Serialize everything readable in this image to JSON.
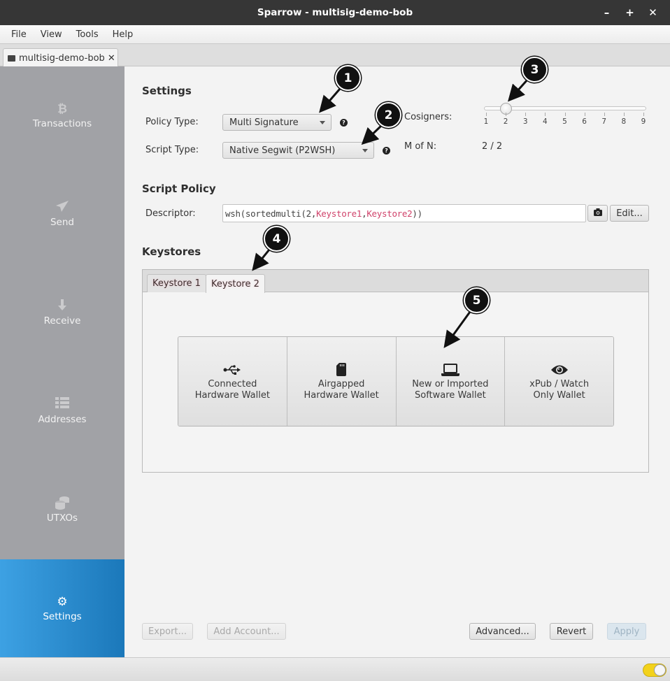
{
  "window": {
    "title": "Sparrow - multisig-demo-bob",
    "controls": {
      "minimize": "–",
      "maximize": "+",
      "close": "✕"
    }
  },
  "menu": [
    "File",
    "View",
    "Tools",
    "Help"
  ],
  "document_tab": {
    "label": "multisig-demo-bob",
    "icon": "wallet-icon",
    "close": "✕"
  },
  "sidebar": {
    "items": [
      {
        "label": "Transactions",
        "icon": "bitcoin-icon",
        "glyph": "₿",
        "active": false
      },
      {
        "label": "Send",
        "icon": "paper-plane-icon",
        "glyph": "➤",
        "active": false
      },
      {
        "label": "Receive",
        "icon": "arrow-down-icon",
        "glyph": "🡇",
        "active": false
      },
      {
        "label": "Addresses",
        "icon": "list-icon",
        "glyph": "☰",
        "active": false
      },
      {
        "label": "UTXOs",
        "icon": "coins-icon",
        "glyph": "⛁",
        "active": false
      },
      {
        "label": "Settings",
        "icon": "gear-icon",
        "glyph": "⚙",
        "active": true
      }
    ]
  },
  "settings": {
    "title": "Settings",
    "policy_type": {
      "label": "Policy Type:",
      "value": "Multi Signature",
      "help": "?"
    },
    "script_type": {
      "label": "Script Type:",
      "value": "Native Segwit (P2WSH)",
      "help": "?"
    },
    "cosigners": {
      "label": "Cosigners:",
      "min": 1,
      "max": 9,
      "value": 2,
      "ticks": [
        "1",
        "2",
        "3",
        "4",
        "5",
        "6",
        "7",
        "8",
        "9"
      ]
    },
    "m_of_n": {
      "label": "M of N:",
      "value": "2 / 2"
    }
  },
  "script_policy": {
    "title": "Script Policy",
    "descriptor_label": "Descriptor:",
    "descriptor": {
      "prefix": "wsh(sortedmulti(2,",
      "ks1": "Keystore1",
      "sep": ",",
      "ks2": "Keystore2",
      "suffix": "))"
    },
    "camera_icon": "camera-icon",
    "edit_label": "Edit..."
  },
  "keystores": {
    "title": "Keystores",
    "tabs": [
      {
        "label": "Keystore 1",
        "active": false
      },
      {
        "label": "Keystore 2",
        "active": true
      }
    ],
    "wallet_options": [
      {
        "line1": "Connected",
        "line2": "Hardware Wallet",
        "icon": "usb-icon"
      },
      {
        "line1": "Airgapped",
        "line2": "Hardware Wallet",
        "icon": "sd-card-icon"
      },
      {
        "line1": "New or Imported",
        "line2": "Software Wallet",
        "icon": "laptop-icon"
      },
      {
        "line1": "xPub / Watch",
        "line2": "Only Wallet",
        "icon": "eye-icon"
      }
    ]
  },
  "footer": {
    "export": "Export...",
    "add_account": "Add Account...",
    "advanced": "Advanced...",
    "revert": "Revert",
    "apply": "Apply"
  },
  "callouts": [
    "1",
    "2",
    "3",
    "4",
    "5"
  ],
  "colors": {
    "accent": "#1b78ba",
    "descriptor_keystore": "#d0436b",
    "toggle_on": "#f3d21b"
  }
}
